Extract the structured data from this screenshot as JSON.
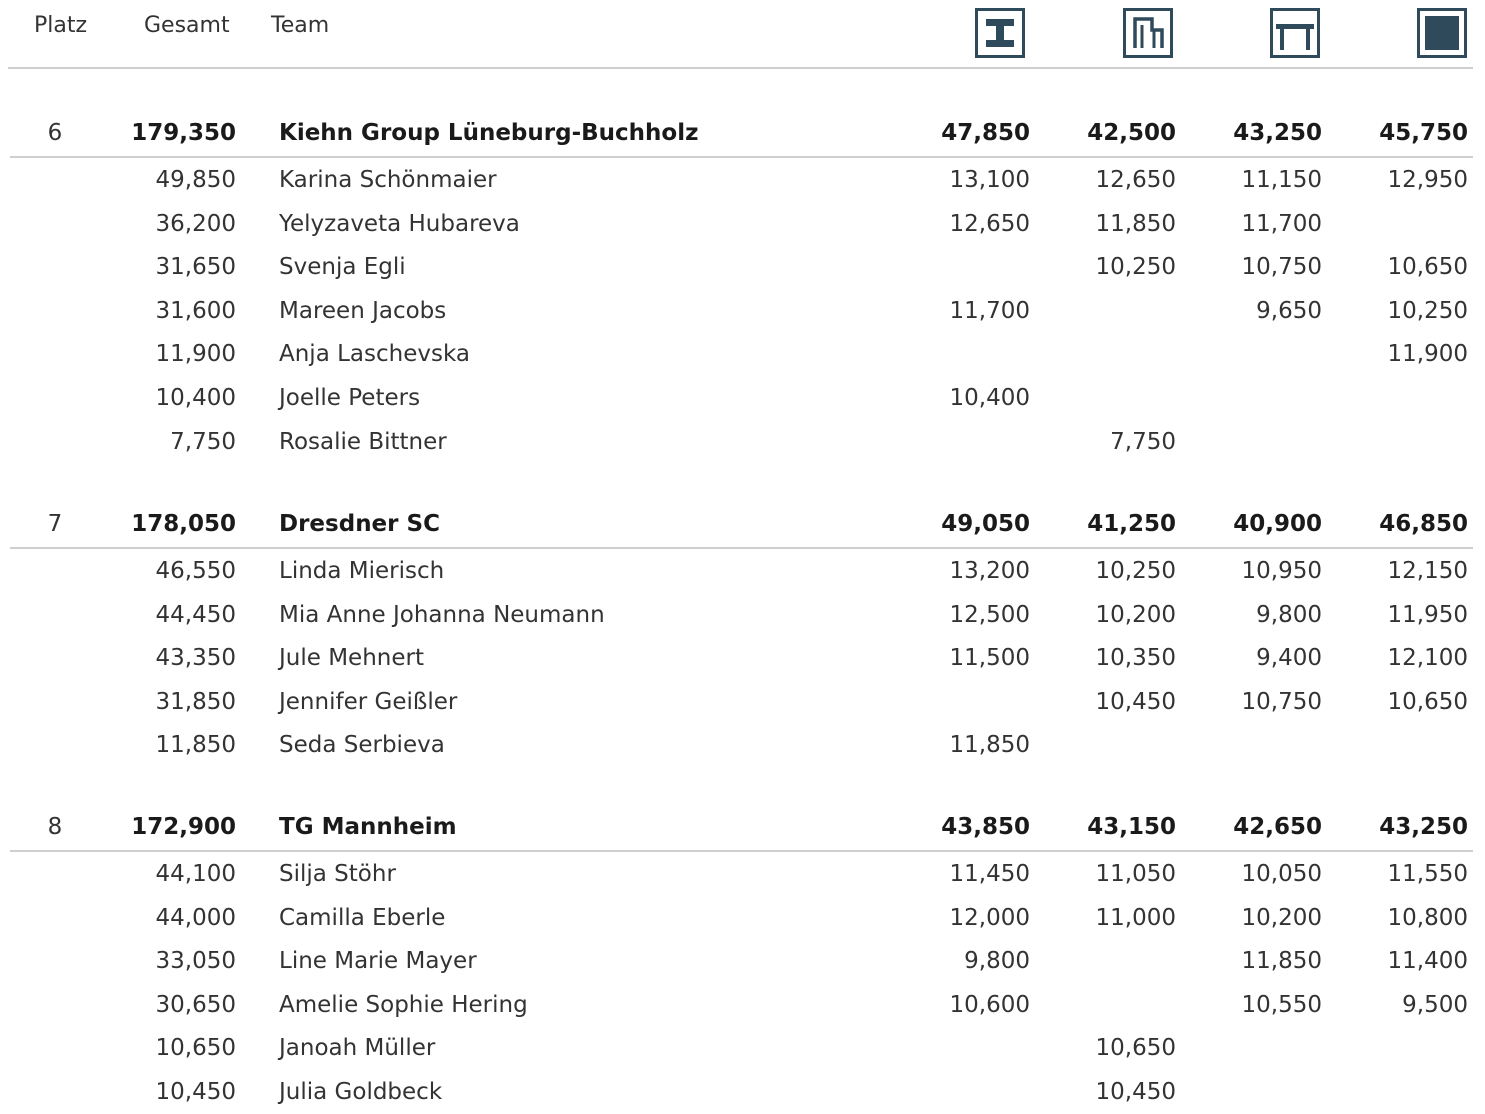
{
  "header": {
    "platz": "Platz",
    "gesamt": "Gesamt",
    "team": "Team",
    "apparatus": [
      {
        "icon": "vault-icon"
      },
      {
        "icon": "uneven-bars-icon"
      },
      {
        "icon": "balance-beam-icon"
      },
      {
        "icon": "floor-icon"
      }
    ]
  },
  "colors": {
    "icon": "#2f4a5a",
    "divider": "#cfcfcf"
  },
  "teams": [
    {
      "rank": "6",
      "total": "179,350",
      "name": "Kiehn Group Lüneburg-Buchholz",
      "scores": [
        "47,850",
        "42,500",
        "43,250",
        "45,750"
      ],
      "athletes": [
        {
          "total": "49,850",
          "name": "Karina Schönmaier",
          "scores": [
            "13,100",
            "12,650",
            "11,150",
            "12,950"
          ]
        },
        {
          "total": "36,200",
          "name": "Yelyzaveta Hubareva",
          "scores": [
            "12,650",
            "11,850",
            "11,700",
            ""
          ]
        },
        {
          "total": "31,650",
          "name": "Svenja Egli",
          "scores": [
            "",
            "10,250",
            "10,750",
            "10,650"
          ]
        },
        {
          "total": "31,600",
          "name": "Mareen Jacobs",
          "scores": [
            "11,700",
            "",
            "9,650",
            "10,250"
          ]
        },
        {
          "total": "11,900",
          "name": "Anja Laschevska",
          "scores": [
            "",
            "",
            "",
            "11,900"
          ]
        },
        {
          "total": "10,400",
          "name": "Joelle Peters",
          "scores": [
            "10,400",
            "",
            "",
            ""
          ]
        },
        {
          "total": "7,750",
          "name": "Rosalie Bittner",
          "scores": [
            "",
            "7,750",
            "",
            ""
          ]
        }
      ]
    },
    {
      "rank": "7",
      "total": "178,050",
      "name": "Dresdner SC",
      "scores": [
        "49,050",
        "41,250",
        "40,900",
        "46,850"
      ],
      "athletes": [
        {
          "total": "46,550",
          "name": "Linda Mierisch",
          "scores": [
            "13,200",
            "10,250",
            "10,950",
            "12,150"
          ]
        },
        {
          "total": "44,450",
          "name": "Mia Anne Johanna Neumann",
          "scores": [
            "12,500",
            "10,200",
            "9,800",
            "11,950"
          ]
        },
        {
          "total": "43,350",
          "name": "Jule Mehnert",
          "scores": [
            "11,500",
            "10,350",
            "9,400",
            "12,100"
          ]
        },
        {
          "total": "31,850",
          "name": "Jennifer Geißler",
          "scores": [
            "",
            "10,450",
            "10,750",
            "10,650"
          ]
        },
        {
          "total": "11,850",
          "name": "Seda Serbieva",
          "scores": [
            "11,850",
            "",
            "",
            ""
          ]
        }
      ]
    },
    {
      "rank": "8",
      "total": "172,900",
      "name": "TG Mannheim",
      "scores": [
        "43,850",
        "43,150",
        "42,650",
        "43,250"
      ],
      "athletes": [
        {
          "total": "44,100",
          "name": "Silja Stöhr",
          "scores": [
            "11,450",
            "11,050",
            "10,050",
            "11,550"
          ]
        },
        {
          "total": "44,000",
          "name": "Camilla Eberle",
          "scores": [
            "12,000",
            "11,000",
            "10,200",
            "10,800"
          ]
        },
        {
          "total": "33,050",
          "name": "Line Marie Mayer",
          "scores": [
            "9,800",
            "",
            "11,850",
            "11,400"
          ]
        },
        {
          "total": "30,650",
          "name": "Amelie Sophie Hering",
          "scores": [
            "10,600",
            "",
            "10,550",
            "9,500"
          ]
        },
        {
          "total": "10,650",
          "name": "Janoah Müller",
          "scores": [
            "",
            "10,650",
            "",
            ""
          ]
        },
        {
          "total": "10,450",
          "name": "Julia Goldbeck",
          "scores": [
            "",
            "10,450",
            "",
            ""
          ]
        }
      ]
    }
  ]
}
